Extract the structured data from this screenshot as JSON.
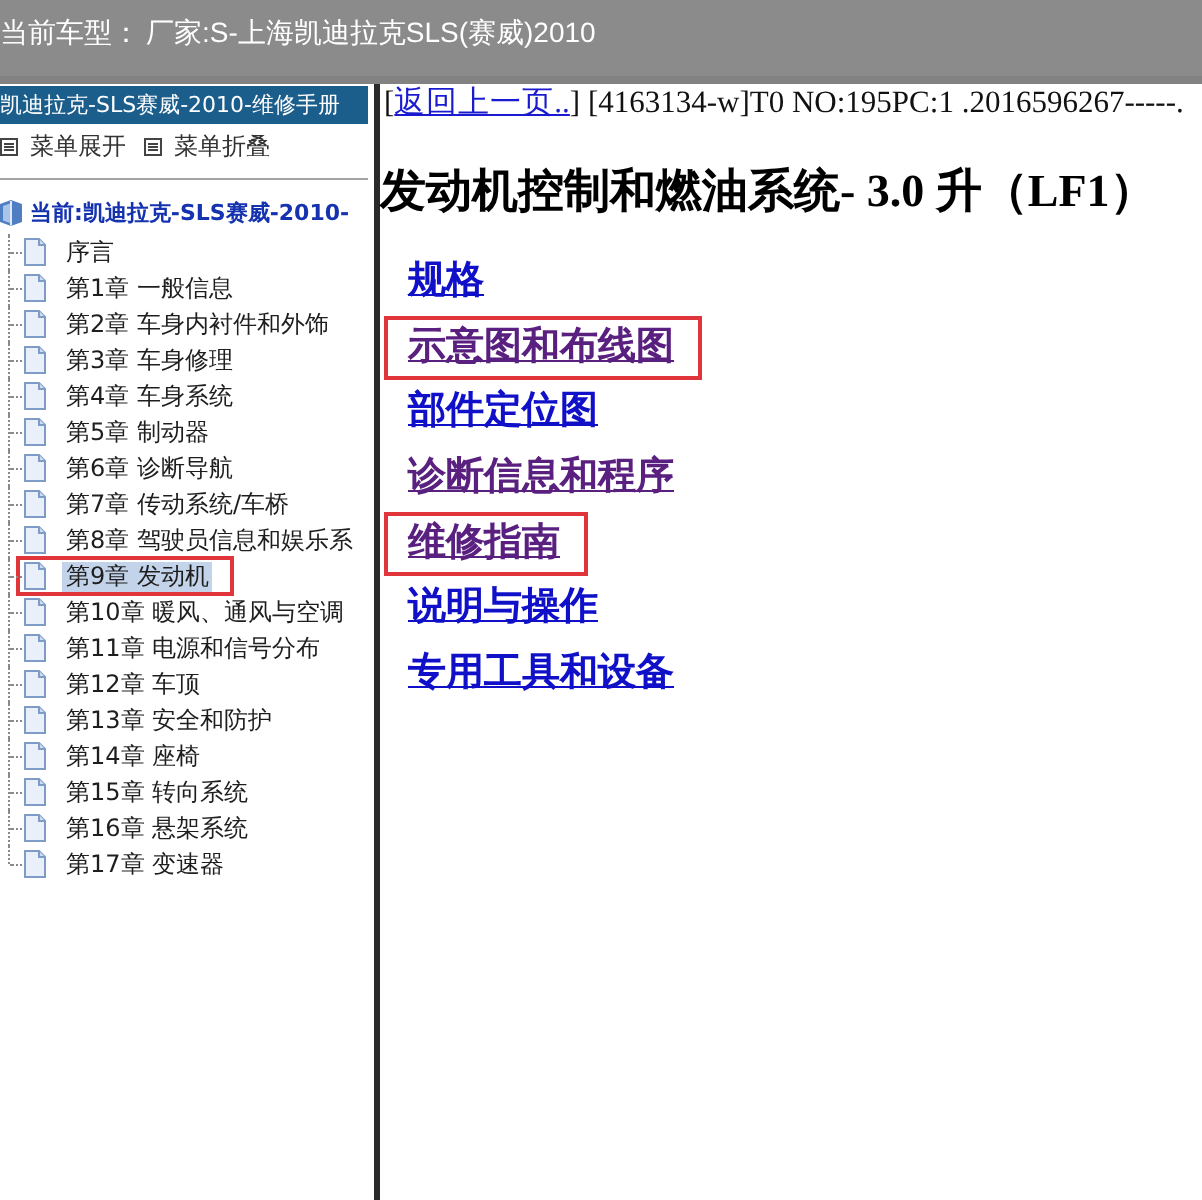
{
  "header": {
    "label": "当前车型：",
    "value": "厂家:S-上海凯迪拉克SLS(赛威)2010"
  },
  "sidebar": {
    "title": "凯迪拉克-SLS赛威-2010-维修手册",
    "menu_actions": [
      {
        "label": "菜单展开"
      },
      {
        "label": "菜单折叠"
      }
    ],
    "tree": {
      "label": "当前:凯迪拉克-SLS赛威-2010-",
      "children": [
        {
          "label": "序言",
          "selected": false,
          "highlighted": false
        },
        {
          "label": "第1章 一般信息",
          "selected": false,
          "highlighted": false
        },
        {
          "label": "第2章 车身内衬件和外饰",
          "selected": false,
          "highlighted": false
        },
        {
          "label": "第3章 车身修理",
          "selected": false,
          "highlighted": false
        },
        {
          "label": "第4章 车身系统",
          "selected": false,
          "highlighted": false
        },
        {
          "label": "第5章 制动器",
          "selected": false,
          "highlighted": false
        },
        {
          "label": "第6章 诊断导航",
          "selected": false,
          "highlighted": false
        },
        {
          "label": "第7章 传动系统/车桥",
          "selected": false,
          "highlighted": false
        },
        {
          "label": "第8章 驾驶员信息和娱乐系",
          "selected": false,
          "highlighted": false
        },
        {
          "label": "第9章 发动机",
          "selected": true,
          "highlighted": true
        },
        {
          "label": "第10章 暖风、通风与空调",
          "selected": false,
          "highlighted": false
        },
        {
          "label": "第11章 电源和信号分布",
          "selected": false,
          "highlighted": false
        },
        {
          "label": "第12章 车顶",
          "selected": false,
          "highlighted": false
        },
        {
          "label": "第13章 安全和防护",
          "selected": false,
          "highlighted": false
        },
        {
          "label": "第14章 座椅",
          "selected": false,
          "highlighted": false
        },
        {
          "label": "第15章 转向系统",
          "selected": false,
          "highlighted": false
        },
        {
          "label": "第16章 悬架系统",
          "selected": false,
          "highlighted": false
        },
        {
          "label": "第17章 变速器",
          "selected": false,
          "highlighted": false
        }
      ]
    }
  },
  "content": {
    "info_line": {
      "prefix": "[",
      "link": "返回上一页..",
      "suffix": "] [4163134-w]T0 NO:195PC:1 .2016596267-----."
    },
    "title": "发动机控制和燃油系统- 3.0 升（LF1）",
    "links": [
      {
        "label": "规格",
        "visited": false,
        "highlighted": false
      },
      {
        "label": "示意图和布线图",
        "visited": true,
        "highlighted": true
      },
      {
        "label": "部件定位图",
        "visited": false,
        "highlighted": false
      },
      {
        "label": "诊断信息和程序",
        "visited": true,
        "highlighted": false
      },
      {
        "label": "维修指南",
        "visited": true,
        "highlighted": true
      },
      {
        "label": "说明与操作",
        "visited": false,
        "highlighted": false
      },
      {
        "label": "专用工具和设备",
        "visited": false,
        "highlighted": false
      }
    ]
  }
}
